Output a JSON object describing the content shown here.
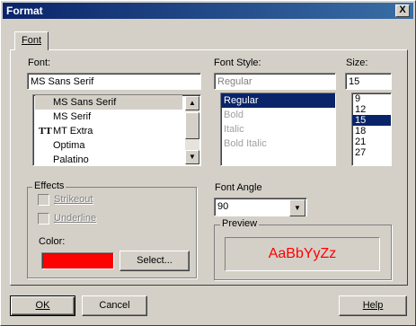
{
  "window": {
    "title": "Format",
    "close_label": "X"
  },
  "tabs": [
    {
      "label": "Font"
    }
  ],
  "font": {
    "label": "Font:",
    "value": "MS Sans Serif",
    "items": [
      {
        "label": "MS Sans Serif",
        "icon": "",
        "selected": true
      },
      {
        "label": "MS Serif",
        "icon": "",
        "selected": false
      },
      {
        "label": "MT Extra",
        "icon": "truetype-icon",
        "selected": false
      },
      {
        "label": "Optima",
        "icon": "",
        "selected": false
      },
      {
        "label": "Palatino",
        "icon": "",
        "selected": false
      }
    ]
  },
  "font_style": {
    "label": "Font Style:",
    "value": "Regular",
    "items": [
      "Regular",
      "Bold",
      "Italic",
      "Bold Italic"
    ],
    "selected": "Regular"
  },
  "size": {
    "label": "Size:",
    "value": "15",
    "items": [
      "9",
      "12",
      "15",
      "18",
      "21",
      "27"
    ],
    "selected": "15"
  },
  "effects": {
    "label": "Effects",
    "strikeout": "Strikeout",
    "underline": "Underline",
    "color_label": "Color:",
    "color_value": "#ff0000",
    "select_button": "Select..."
  },
  "angle": {
    "label": "Font Angle",
    "value": "90"
  },
  "preview": {
    "label": "Preview",
    "text": "AaBbYyZz",
    "color": "#ff0000"
  },
  "buttons": {
    "ok": "OK",
    "cancel": "Cancel",
    "help": "Help"
  }
}
